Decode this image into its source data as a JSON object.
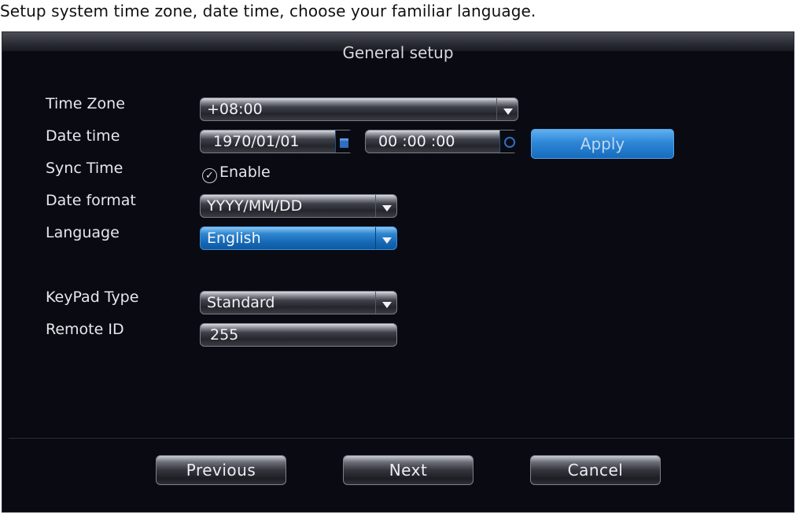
{
  "caption": "Setup system time zone, date time, choose your familiar language.",
  "window": {
    "title": "General setup"
  },
  "form": {
    "time_zone": {
      "label": "Time Zone",
      "value": "+08:00"
    },
    "date_time": {
      "label": "Date time",
      "date": "1970/01/01",
      "time": "00 :00 :00",
      "apply_label": "Apply"
    },
    "sync_time": {
      "label": "Sync Time",
      "checkbox_label": "Enable",
      "checked": true
    },
    "date_format": {
      "label": "Date format",
      "value": "YYYY/MM/DD"
    },
    "language": {
      "label": "Language",
      "value": "English"
    },
    "keypad_type": {
      "label": "KeyPad Type",
      "value": "Standard"
    },
    "remote_id": {
      "label": "Remote ID",
      "value": "255"
    }
  },
  "footer": {
    "previous_label": "Previous",
    "next_label": "Next",
    "cancel_label": "Cancel"
  },
  "colors": {
    "background": "#090a12",
    "accent": "#1f7ccc"
  },
  "icons": {
    "calendar": "calendar-icon",
    "clock": "clock-icon",
    "dropdown": "chevron-down-icon",
    "check": "check-icon"
  }
}
